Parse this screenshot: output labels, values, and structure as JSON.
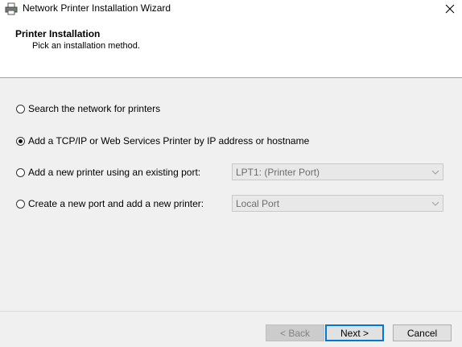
{
  "window": {
    "title": "Network Printer Installation Wizard"
  },
  "header": {
    "title": "Printer Installation",
    "subtitle": "Pick an installation method."
  },
  "options": [
    {
      "label": "Search the network for printers",
      "checked": false
    },
    {
      "label": "Add a TCP/IP or Web Services Printer by IP address or hostname",
      "checked": true
    },
    {
      "label": "Add a new printer using an existing port:",
      "checked": false
    },
    {
      "label": "Create a new port and add a new printer:",
      "checked": false
    }
  ],
  "combos": {
    "existing_port": "LPT1: (Printer Port)",
    "new_port_type": "Local Port"
  },
  "buttons": {
    "back": "< Back",
    "next": "Next >",
    "cancel": "Cancel"
  }
}
